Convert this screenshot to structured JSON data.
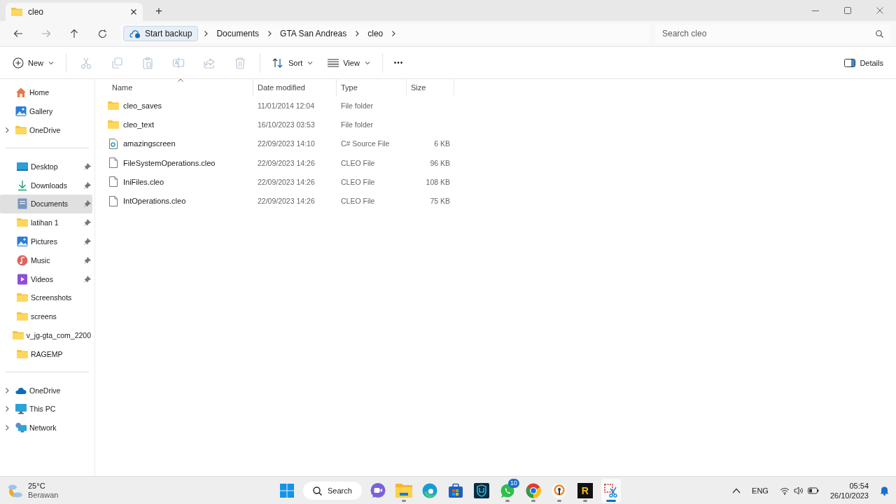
{
  "window": {
    "tab_title": "cleo",
    "new_tab": "+"
  },
  "nav": {
    "breadcrumb": [
      {
        "label": "Start backup",
        "kind": "backup"
      },
      {
        "label": "Documents",
        "kind": "crumb"
      },
      {
        "label": "GTA San Andreas",
        "kind": "crumb"
      },
      {
        "label": "cleo",
        "kind": "crumb"
      }
    ],
    "search": {
      "placeholder": "Search cleo"
    }
  },
  "toolbar": {
    "new_label": "New",
    "actions": [
      {
        "kind": "cut",
        "disabled": true
      },
      {
        "kind": "copy",
        "disabled": true
      },
      {
        "kind": "paste",
        "disabled": true
      },
      {
        "kind": "rename",
        "disabled": true
      },
      {
        "kind": "share",
        "disabled": true
      },
      {
        "kind": "delete",
        "disabled": true
      }
    ],
    "sort_label": "Sort",
    "view_label": "View",
    "more": "•••",
    "details_label": "Details"
  },
  "sidebar": {
    "sections": [
      [
        {
          "label": "Home",
          "kind": "home",
          "expandable": false,
          "pinned": false,
          "selected": false
        },
        {
          "label": "Gallery",
          "kind": "gallery",
          "expandable": false,
          "pinned": false,
          "selected": false
        },
        {
          "label": "OneDrive",
          "kind": "folder",
          "expandable": true,
          "pinned": false,
          "selected": false
        }
      ],
      [
        {
          "label": "Desktop",
          "kind": "desktop",
          "expandable": false,
          "pinned": true,
          "selected": false
        },
        {
          "label": "Downloads",
          "kind": "downloads",
          "expandable": false,
          "pinned": true,
          "selected": false
        },
        {
          "label": "Documents",
          "kind": "documents",
          "expandable": false,
          "pinned": true,
          "selected": true
        },
        {
          "label": "latihan 1",
          "kind": "folder",
          "expandable": false,
          "pinned": true,
          "selected": false
        },
        {
          "label": "Pictures",
          "kind": "pictures",
          "expandable": false,
          "pinned": true,
          "selected": false
        },
        {
          "label": "Music",
          "kind": "music",
          "expandable": false,
          "pinned": true,
          "selected": false
        },
        {
          "label": "Videos",
          "kind": "videos",
          "expandable": false,
          "pinned": true,
          "selected": false
        },
        {
          "label": "Screenshots",
          "kind": "folder",
          "expandable": false,
          "pinned": false,
          "selected": false
        },
        {
          "label": "screens",
          "kind": "folder",
          "expandable": false,
          "pinned": false,
          "selected": false
        },
        {
          "label": "v_jg-gta_com_2200",
          "kind": "folder",
          "expandable": false,
          "pinned": false,
          "selected": false
        },
        {
          "label": "RAGEMP",
          "kind": "folder",
          "expandable": false,
          "pinned": false,
          "selected": false
        }
      ],
      [
        {
          "label": "OneDrive",
          "kind": "cloud",
          "expandable": true,
          "pinned": false,
          "selected": false
        },
        {
          "label": "This PC",
          "kind": "pc",
          "expandable": true,
          "pinned": false,
          "selected": false
        },
        {
          "label": "Network",
          "kind": "network",
          "expandable": true,
          "pinned": false,
          "selected": false
        }
      ]
    ]
  },
  "table": {
    "columns": [
      "Name",
      "Date modified",
      "Type",
      "Size"
    ],
    "rows": [
      {
        "kind": "folder",
        "name": "cleo_saves",
        "date": "11/01/2014 12:04",
        "type": "File folder"
      },
      {
        "kind": "folder",
        "name": "cleo_text",
        "date": "16/10/2023 03:53",
        "type": "File folder"
      },
      {
        "kind": "source",
        "name": "amazingscreen",
        "date": "22/09/2023 14:10",
        "type": "C# Source File",
        "size": "6 KB"
      },
      {
        "kind": "file",
        "name": "FileSystemOperations.cleo",
        "date": "22/09/2023 14:26",
        "type": "CLEO File",
        "size": "96 KB"
      },
      {
        "kind": "file",
        "name": "IniFiles.cleo",
        "date": "22/09/2023 14:26",
        "type": "CLEO File",
        "size": "108 KB"
      },
      {
        "kind": "file",
        "name": "IntOperations.cleo",
        "date": "22/09/2023 14:26",
        "type": "CLEO File",
        "size": "75 KB"
      }
    ]
  },
  "taskbar": {
    "weather": {
      "temp": "25°C",
      "condition": "Berawan"
    },
    "search_label": "Search",
    "apps": [
      {
        "kind": "chat",
        "running": false,
        "selected": false
      },
      {
        "kind": "explorer",
        "running": true,
        "selected": false
      },
      {
        "kind": "edge",
        "running": false,
        "selected": false
      },
      {
        "kind": "store",
        "running": false,
        "selected": false
      },
      {
        "kind": "shield",
        "running": false,
        "selected": false
      },
      {
        "kind": "whatsapp",
        "running": true,
        "selected": false,
        "badge": "10"
      },
      {
        "kind": "chrome",
        "running": true,
        "selected": false
      },
      {
        "kind": "lock",
        "running": true,
        "selected": false
      },
      {
        "kind": "rapp",
        "running": true,
        "selected": false,
        "glyph": "R"
      },
      {
        "kind": "snip",
        "running": true,
        "selected": true
      }
    ],
    "language": "ENG",
    "time": "05:54",
    "date": "26/10/2023"
  }
}
